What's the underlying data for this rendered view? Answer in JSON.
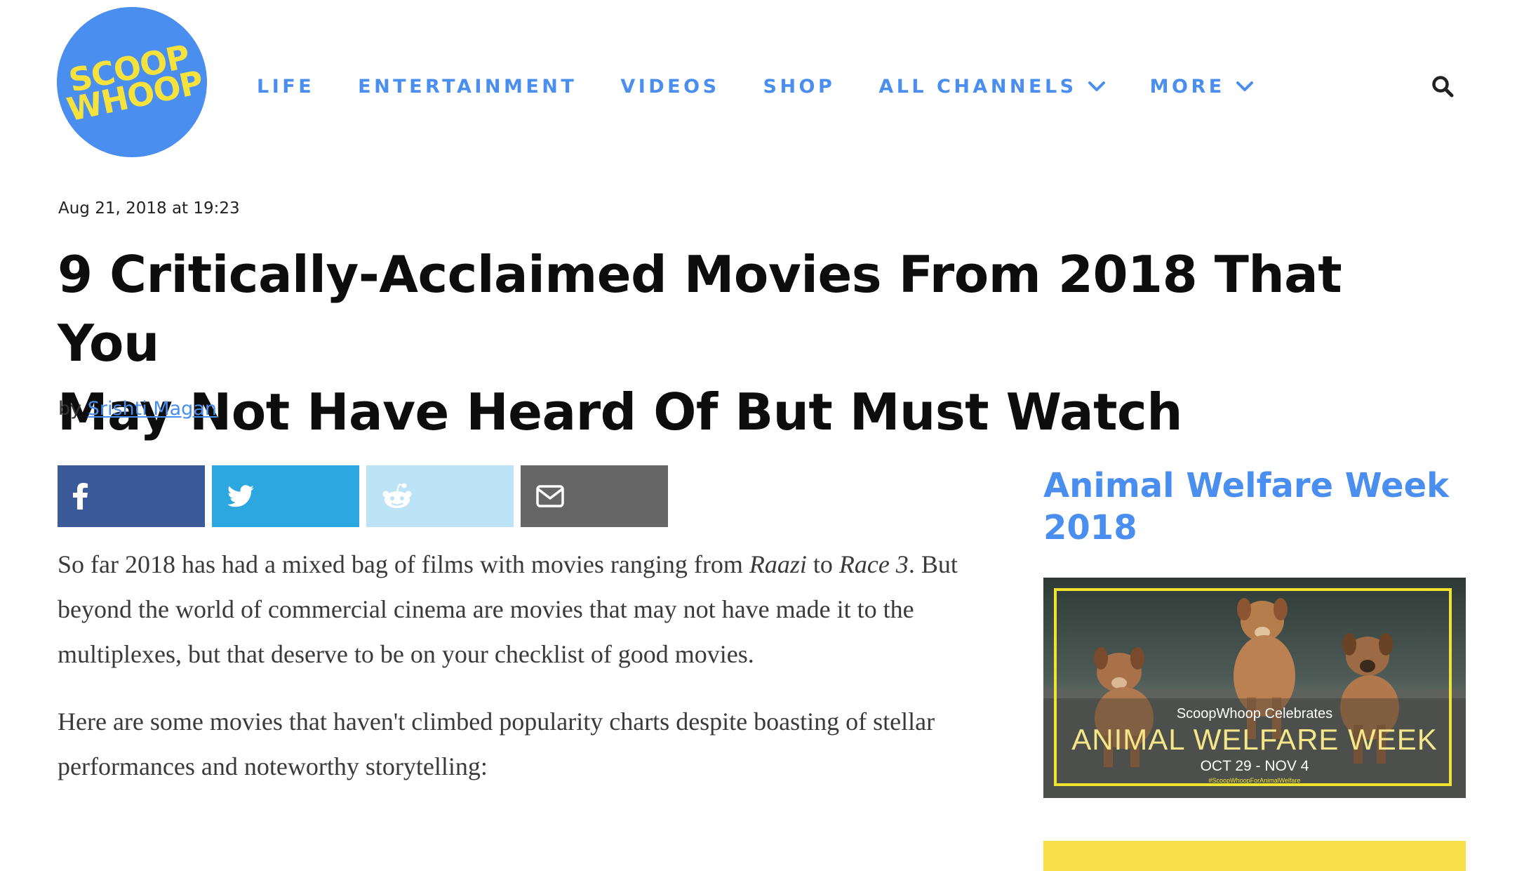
{
  "site": {
    "logo_lines": [
      "SCOOP",
      "WHOOP"
    ],
    "brand_color": "#4a8ef0",
    "logo_text_color": "#f6e23c"
  },
  "nav": {
    "items": [
      {
        "label": "LIFE",
        "has_dropdown": false
      },
      {
        "label": "ENTERTAINMENT",
        "has_dropdown": false
      },
      {
        "label": "VIDEOS",
        "has_dropdown": false
      },
      {
        "label": "SHOP",
        "has_dropdown": false
      },
      {
        "label": "ALL CHANNELS",
        "has_dropdown": true
      },
      {
        "label": "MORE",
        "has_dropdown": true
      }
    ],
    "search_icon": "search-icon"
  },
  "article": {
    "timestamp": "Aug 21, 2018 at 19:23",
    "title_lines": [
      "9 Critically-Acclaimed Movies From 2018 That You",
      "May Not Have Heard Of But Must Watch"
    ],
    "byline_prefix": "by",
    "author": "Srishti Magan",
    "paragraph1": {
      "t1": "So far 2018 has had a mixed bag of films with movies ranging from ",
      "em1": "Raazi",
      "t2": " to ",
      "em2": "Race 3",
      "t3": ". But beyond the world of commercial cinema are movies that may not have made it to the multiplexes, but that deserve to be on your checklist of good movies."
    },
    "paragraph2": "Here are some movies that haven't climbed popularity charts despite boasting of stellar performances and noteworthy storytelling:"
  },
  "share": {
    "buttons": [
      {
        "icon": "facebook-icon",
        "color": "#3b5a9a"
      },
      {
        "icon": "twitter-icon",
        "color": "#2da7e0"
      },
      {
        "icon": "reddit-icon",
        "color": "#bde3f7"
      },
      {
        "icon": "email-icon",
        "color": "#666666"
      }
    ]
  },
  "sidebar": {
    "title": "Animal Welfare Week 2018",
    "promo": {
      "line1": "ScoopWhoop Celebrates",
      "line2": "ANIMAL WELFARE WEEK",
      "line3": "OCT 29 - NOV 4",
      "line4": "#ScoopWhoopForAnimalWelfare"
    },
    "ad_color": "#f8e04a"
  }
}
